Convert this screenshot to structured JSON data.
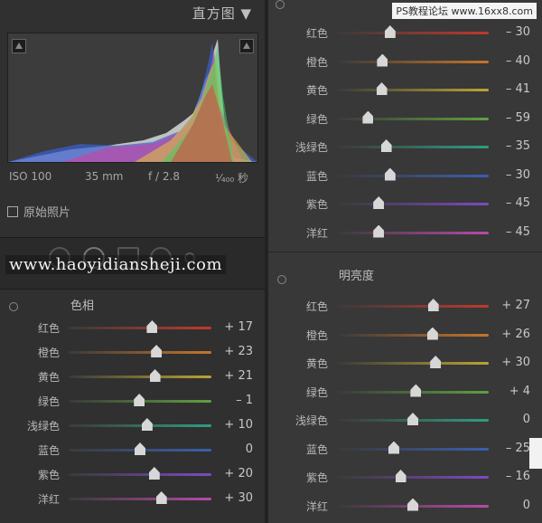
{
  "watermark_top": "PS教程论坛 www.16xx8.com",
  "watermark_main": "www.haoyidiansheji.com",
  "histogram": {
    "title": "直方图 ▼",
    "iso": "ISO 100",
    "focal": "35 mm",
    "aperture": "f / 2.8",
    "shutter": "¹⁄₄₀₀ 秒",
    "original_label": "原始照片"
  },
  "colors": {
    "red": "#c0392b",
    "orange": "#c8742a",
    "yellow": "#b9a531",
    "green": "#5fa040",
    "aqua": "#2f9d82",
    "blue": "#3a5fb0",
    "purple": "#7d4ac0",
    "magenta": "#b84aa8"
  },
  "hue": {
    "title": "色相",
    "rows": [
      {
        "label": "红色",
        "value": "+ 17",
        "pos": 17
      },
      {
        "label": "橙色",
        "value": "+ 23",
        "pos": 23
      },
      {
        "label": "黄色",
        "value": "+ 21",
        "pos": 21
      },
      {
        "label": "绿色",
        "value": "– 1",
        "pos": -1
      },
      {
        "label": "浅绿色",
        "value": "+ 10",
        "pos": 10
      },
      {
        "label": "蓝色",
        "value": "0",
        "pos": 0
      },
      {
        "label": "紫色",
        "value": "+ 20",
        "pos": 20
      },
      {
        "label": "洋红",
        "value": "+ 30",
        "pos": 30
      }
    ]
  },
  "saturation": {
    "rows": [
      {
        "label": "红色",
        "value": "– 30",
        "pos": -30
      },
      {
        "label": "橙色",
        "value": "– 40",
        "pos": -40
      },
      {
        "label": "黄色",
        "value": "– 41",
        "pos": -41
      },
      {
        "label": "绿色",
        "value": "– 59",
        "pos": -59
      },
      {
        "label": "浅绿色",
        "value": "– 35",
        "pos": -35
      },
      {
        "label": "蓝色",
        "value": "– 30",
        "pos": -30
      },
      {
        "label": "紫色",
        "value": "– 45",
        "pos": -45
      },
      {
        "label": "洋红",
        "value": "– 45",
        "pos": -45
      }
    ]
  },
  "luminance": {
    "title": "明亮度",
    "rows": [
      {
        "label": "红色",
        "value": "+ 27",
        "pos": 27
      },
      {
        "label": "橙色",
        "value": "+ 26",
        "pos": 26
      },
      {
        "label": "黄色",
        "value": "+ 30",
        "pos": 30
      },
      {
        "label": "绿色",
        "value": "+ 4",
        "pos": 4
      },
      {
        "label": "浅绿色",
        "value": "0",
        "pos": 0
      },
      {
        "label": "蓝色",
        "value": "– 25",
        "pos": -25
      },
      {
        "label": "紫色",
        "value": "– 16",
        "pos": -16
      },
      {
        "label": "洋红",
        "value": "0",
        "pos": 0
      }
    ]
  }
}
